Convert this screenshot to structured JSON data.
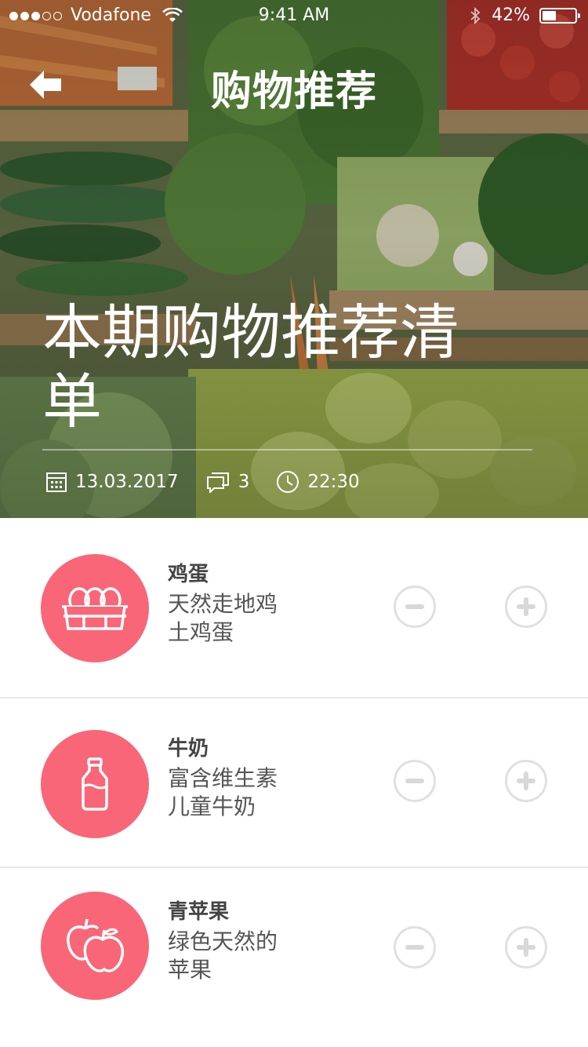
{
  "status_bar": {
    "carrier": "Vodafone",
    "time": "9:41 AM",
    "battery_percent": "42%",
    "battery_level": 0.42,
    "signal_bars_filled": 3,
    "signal_bars_total": 5
  },
  "nav": {
    "title": "购物推荐",
    "back_icon": "arrow-left-icon"
  },
  "hero": {
    "headline": "本期购物推荐清单",
    "date": "13.03.2017",
    "comments": "3",
    "time": "22:30",
    "icons": [
      "calendar-icon",
      "comment-icon",
      "clock-icon"
    ]
  },
  "items": [
    {
      "name": "鸡蛋",
      "description": "天然走地鸡土鸡蛋",
      "icon": "eggs-icon"
    },
    {
      "name": "牛奶",
      "description": "富含维生素儿童牛奶",
      "icon": "milk-bottle-icon"
    },
    {
      "name": "青苹果",
      "description": "绿色天然的苹果",
      "icon": "apples-icon"
    }
  ],
  "colors": {
    "accent": "#f96677",
    "control_border": "#e0e0e0",
    "divider": "#e8e8e8"
  }
}
